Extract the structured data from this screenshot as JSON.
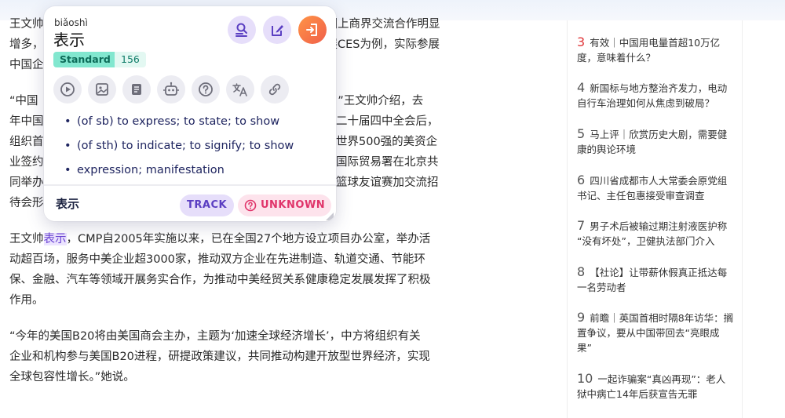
{
  "article": {
    "paragraphs": [
      {
        "lines": [
          "王文帅",
          "增多，",
          "中国企"
        ]
      },
      {
        "lines": [
          "“中国",
          "年中国",
          "组织首",
          "业签约",
          "同举办",
          "待会形"
        ]
      },
      {
        "lines": [
          "王文帅",
          "动超百场，服务中美企业超3000家，推动双方企业在先进制造、轨道交通、节能环",
          "保、金融、汽车等领域开展务实合作，为推动中美经贸关系健康稳定发展发挥了积极",
          "作用。"
        ]
      },
      {
        "lines": [
          "“今年的美国B20将由美国商会主办，主题为‘加速全球经济增长’，中方将组织有关",
          "企业和机构参与美国B20进程，研提政策建议，共同推动构建开放型世界经济，实现",
          "全球包容性增长。”她说。"
        ]
      }
    ],
    "right_fragments": [
      "国上商界交流合作明显",
      "展CES为例，实际参展",
      "用。”王文帅介绍，去",
      "的二十届四中全会后，",
      "家世界500强的美资企",
      "部国际贸易署在北京共",
      "取篮球友谊赛加交流招"
    ],
    "highlight_word": "表示",
    "highlight_rest": "，CMP自2005年实施以来，已在全国27个地方设立项目办公室，举办活"
  },
  "ranking": [
    {
      "num": "3",
      "lines": [
        "有效｜中国用电量首超10万亿",
        "度，意味着什么？"
      ]
    },
    {
      "num": "4",
      "lines": [
        "新国标与地方整治齐发力，电动",
        "自行车治理如何从焦虑到破局？"
      ]
    },
    {
      "num": "5",
      "lines": [
        "马上评｜欣赏历史大剧，需要健",
        "康的舆论环境"
      ]
    },
    {
      "num": "6",
      "lines": [
        "四川省成都市人大常委会原党组",
        "书记、主任包惠接受审查调查"
      ]
    },
    {
      "num": "7",
      "lines": [
        "男子术后被输过期注射液医护称",
        "“没有坏处”，卫健执法部门介入"
      ]
    },
    {
      "num": "8",
      "lines": [
        "【社论】让带薪休假真正抵达每",
        "一名劳动者"
      ]
    },
    {
      "num": "9",
      "lines": [
        "前瞻｜英国首相时隔8年访华：搁",
        "置争议，要从中国带回去“亮眼成",
        "果”"
      ]
    },
    {
      "num": "10",
      "lines": [
        "一起诈骗案“真凶再现”：老人",
        "狱中病亡14年后获宣告无罪"
      ]
    }
  ],
  "popup": {
    "pinyin": "biǎoshì",
    "word": "表示",
    "level": "Standard",
    "frequency": "156",
    "header_icons": [
      "search-list-icon",
      "edit-note-icon",
      "exit-icon"
    ],
    "tool_icons": [
      "play-icon",
      "image-icon",
      "document-icon",
      "robot-icon",
      "help-icon",
      "translate-icon",
      "link-icon"
    ],
    "definitions": [
      "(of sb) to express; to state; to show",
      "(of sth) to indicate; to signify; to show",
      "expression; manifestation"
    ],
    "footer_word": "表示",
    "track_label": "TRACK",
    "unknown_label": "UNKNOWN",
    "accent": "#6d46d4",
    "unknown_color": "#e0346a"
  }
}
